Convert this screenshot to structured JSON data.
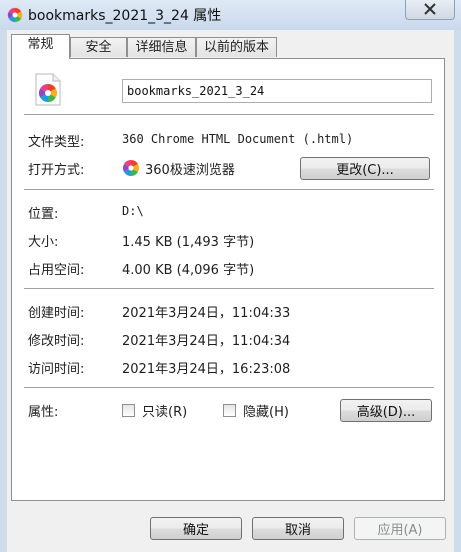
{
  "window": {
    "title": "bookmarks_2021_3_24 属性"
  },
  "tabs": [
    {
      "label": "常规"
    },
    {
      "label": "安全"
    },
    {
      "label": "详细信息"
    },
    {
      "label": "以前的版本"
    }
  ],
  "general": {
    "file_name": "bookmarks_2021_3_24",
    "file_type_label": "文件类型:",
    "file_type_value": "360 Chrome HTML Document (.html)",
    "opens_with_label": "打开方式:",
    "opens_with_value": "360极速浏览器",
    "change_button": "更改(C)...",
    "location_label": "位置:",
    "location_value": "D:\\",
    "size_label": "大小:",
    "size_value": "1.45 KB (1,493 字节)",
    "size_on_disk_label": "占用空间:",
    "size_on_disk_value": "4.00 KB (4,096 字节)",
    "created_label": "创建时间:",
    "created_value": "2021年3月24日，11:04:33",
    "modified_label": "修改时间:",
    "modified_value": "2021年3月24日，11:04:34",
    "accessed_label": "访问时间:",
    "accessed_value": "2021年3月24日，16:23:08",
    "attributes_label": "属性:",
    "readonly_label": "只读(R)",
    "hidden_label": "隐藏(H)",
    "advanced_button": "高级(D)..."
  },
  "footer": {
    "ok_button": "确定",
    "cancel_button": "取消",
    "apply_button": "应用(A)"
  }
}
